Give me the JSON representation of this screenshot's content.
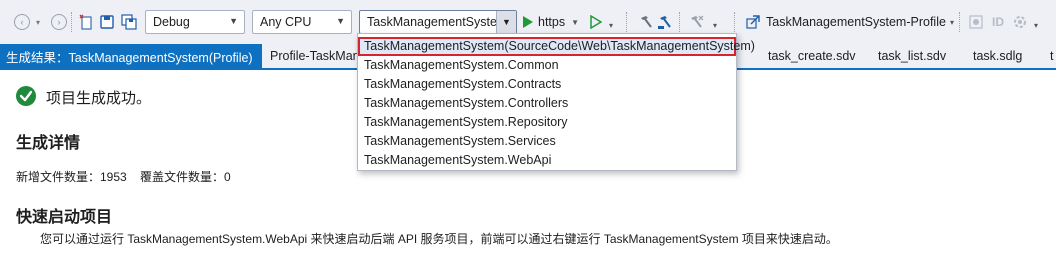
{
  "toolbar": {
    "configuration": "Debug",
    "platform": "Any CPU",
    "startup_project": "TaskManagementSyste",
    "run_target": "https",
    "profile": "TaskManagementSystem-Profile"
  },
  "tabs": [
    {
      "label": "生成结果：TaskManagementSystem(Profile)",
      "close": "✕"
    },
    {
      "label": "Profile-TaskMan"
    },
    {
      "label": "task_create.sdv"
    },
    {
      "label": "task_list.sdv"
    },
    {
      "label": "task.sdlg"
    },
    {
      "label": "t"
    }
  ],
  "dropdown": {
    "items": [
      "TaskManagementSystem(SourceCode\\Web\\TaskManagementSystem)",
      "TaskManagementSystem.Common",
      "TaskManagementSystem.Contracts",
      "TaskManagementSystem.Controllers",
      "TaskManagementSystem.Repository",
      "TaskManagementSystem.Services",
      "TaskManagementSystem.WebApi"
    ],
    "selected_index": 0
  },
  "content": {
    "success_message": "项目生成成功。",
    "details_heading": "生成详情",
    "new_files": "新增文件数量：1953",
    "overwritten_files": "覆盖文件数量：0",
    "quickstart_heading": "快速启动项目",
    "quickstart_description": "您可以通过运行 TaskManagementSystem.WebApi 来快速启动后端 API 服务项目，前端可以通过右键运行 TaskManagementSystem 项目来快速启动。"
  },
  "colors": {
    "accent": "#0e70c0",
    "success": "#1f8a3b",
    "highlight_border": "#d9242e",
    "run_green": "#1f9a3a"
  }
}
